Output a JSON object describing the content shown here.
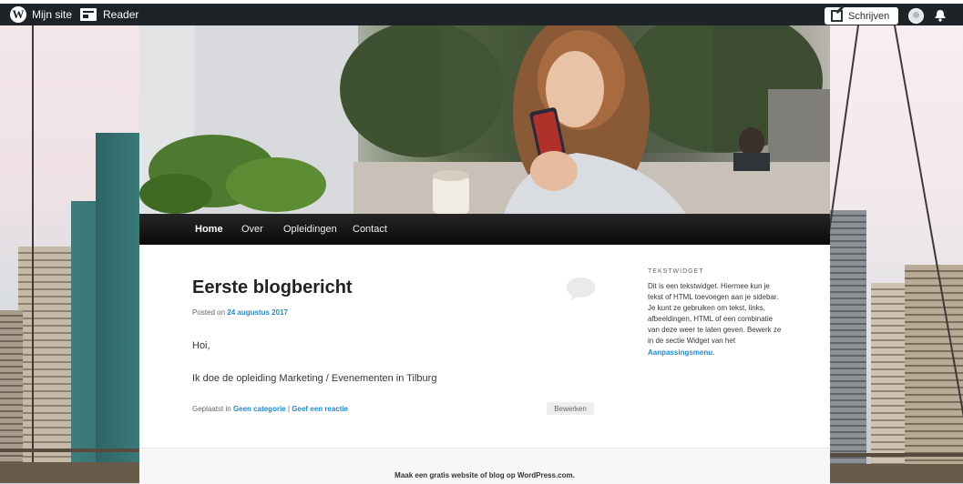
{
  "adminbar": {
    "my_site": "Mijn site",
    "reader": "Reader",
    "write": "Schrijven"
  },
  "nav": {
    "items": [
      {
        "label": "Home"
      },
      {
        "label": "Over"
      },
      {
        "label": "Opleidingen"
      },
      {
        "label": "Contact"
      }
    ]
  },
  "post": {
    "title": "Eerste blogbericht",
    "posted_prefix": "Posted on",
    "date": "24 augustus 2017",
    "paragraphs": [
      "Hoi,",
      "Ik doe de opleiding Marketing / Evenementen in Tilburg"
    ],
    "meta_prefix": "Geplaatst in",
    "category": "Geen categorie",
    "separator": "|",
    "reply_link": "Geef een reactie",
    "edit": "Bewerken"
  },
  "widget": {
    "title": "TEKSTWIDGET",
    "text": "Dit is een tekstwidget. Hiermee kun je tekst of HTML toevoegen aan je sidebar. Je kunt ze gebruiken om tekst, links, afbeeldingen, HTML of een combinatie van deze weer te laten geven. Bewerk ze in de sectie Widget van het",
    "link": "Aanpassingsmenu",
    "end": "."
  },
  "footer": {
    "text": "Maak een gratis website of blog op WordPress.com."
  },
  "colors": {
    "adminbar_bg": "#1d2327",
    "link": "#1b8be0",
    "nav_bg": "#0b0b0b"
  }
}
